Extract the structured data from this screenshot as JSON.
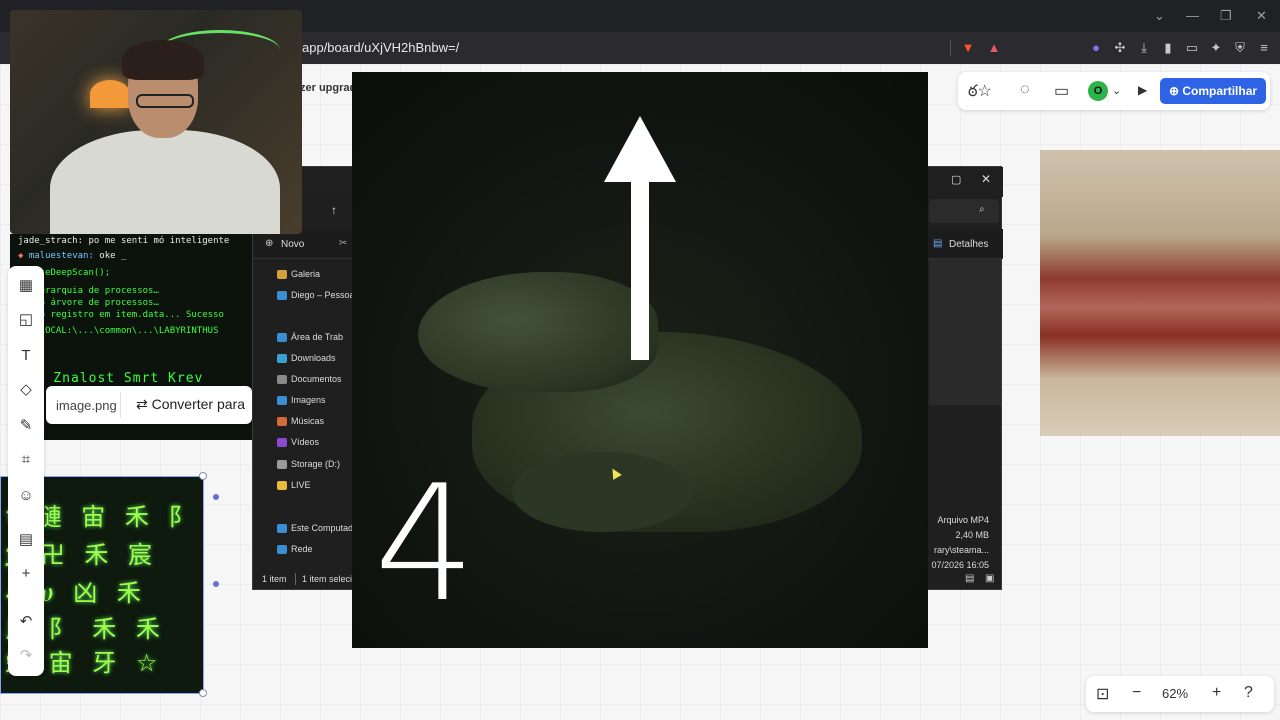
{
  "browser": {
    "url": "app/board/uXjVH2hBnbw=/"
  },
  "board": {
    "upgrade_text": "zer upgrad",
    "share_label": "Compartilhar",
    "avatar_letter": "O",
    "zoom": "62%",
    "image_bar": {
      "filename": "image.png",
      "convert_label": "Converter para"
    }
  },
  "terminal": {
    "chat": [
      {
        "user": "jade_strach:",
        "text": "po me senti mó inteligente"
      },
      {
        "user": "maluestevan:",
        "text": "oke _"
      }
    ],
    "lines": [
      "xecuteDeepScan();",
      "o hierarquia de processos…",
      "zando árvore de processos…",
      "zando registro em item.data... Sucesso",
      "RID_LOCAL:\\...\\common\\...\\LABYRINTHUS"
    ],
    "big_line": "gie Znalost Smrt Krev"
  },
  "explorer": {
    "new_label": "Novo",
    "details_label": "Detalhes",
    "nav_items": [
      {
        "label": "Galeria",
        "color": "#d4a13a",
        "pinned": false
      },
      {
        "label": "Diego – Pessoal",
        "color": "#3a8fd4",
        "pinned": false
      },
      {
        "label": "Área de Trab",
        "color": "#3a8fd4",
        "pinned": true
      },
      {
        "label": "Downloads",
        "color": "#3aa0d4",
        "pinned": true
      },
      {
        "label": "Documentos",
        "color": "#8a8a8a",
        "pinned": true
      },
      {
        "label": "Imagens",
        "color": "#3a8fd4",
        "pinned": true
      },
      {
        "label": "Músicas",
        "color": "#d46a3a",
        "pinned": true
      },
      {
        "label": "Vídeos",
        "color": "#8a4ad4",
        "pinned": true
      },
      {
        "label": "Storage (D:)",
        "color": "#9a9a9a",
        "pinned": true
      },
      {
        "label": "LIVE",
        "color": "#e8b93a",
        "pinned": false
      },
      {
        "label": "Este Computad",
        "color": "#3a8fd4",
        "pinned": false
      },
      {
        "label": "Rede",
        "color": "#3a8fd4",
        "pinned": false
      }
    ],
    "status_count": "1 item",
    "status_selected": "1 item seleci",
    "file_type": "Arquivo MP4",
    "file_size": "2,40 MB",
    "file_path": "rary\\steama...",
    "file_date": "07/2026 16:05"
  },
  "video": {
    "number": "4"
  },
  "glyphs": [
    "⚕ 漣 宙 禾 阝",
    "ጀ 卍 禾 宸",
    "ቆ ሀ 凶 禾",
    "斤 阝 禾 禾",
    "栄 宙 牙 ☆"
  ],
  "colors": {
    "share": "#2f63e6",
    "terminal_green": "#39ff3e",
    "avatar": "#2eb34a"
  }
}
